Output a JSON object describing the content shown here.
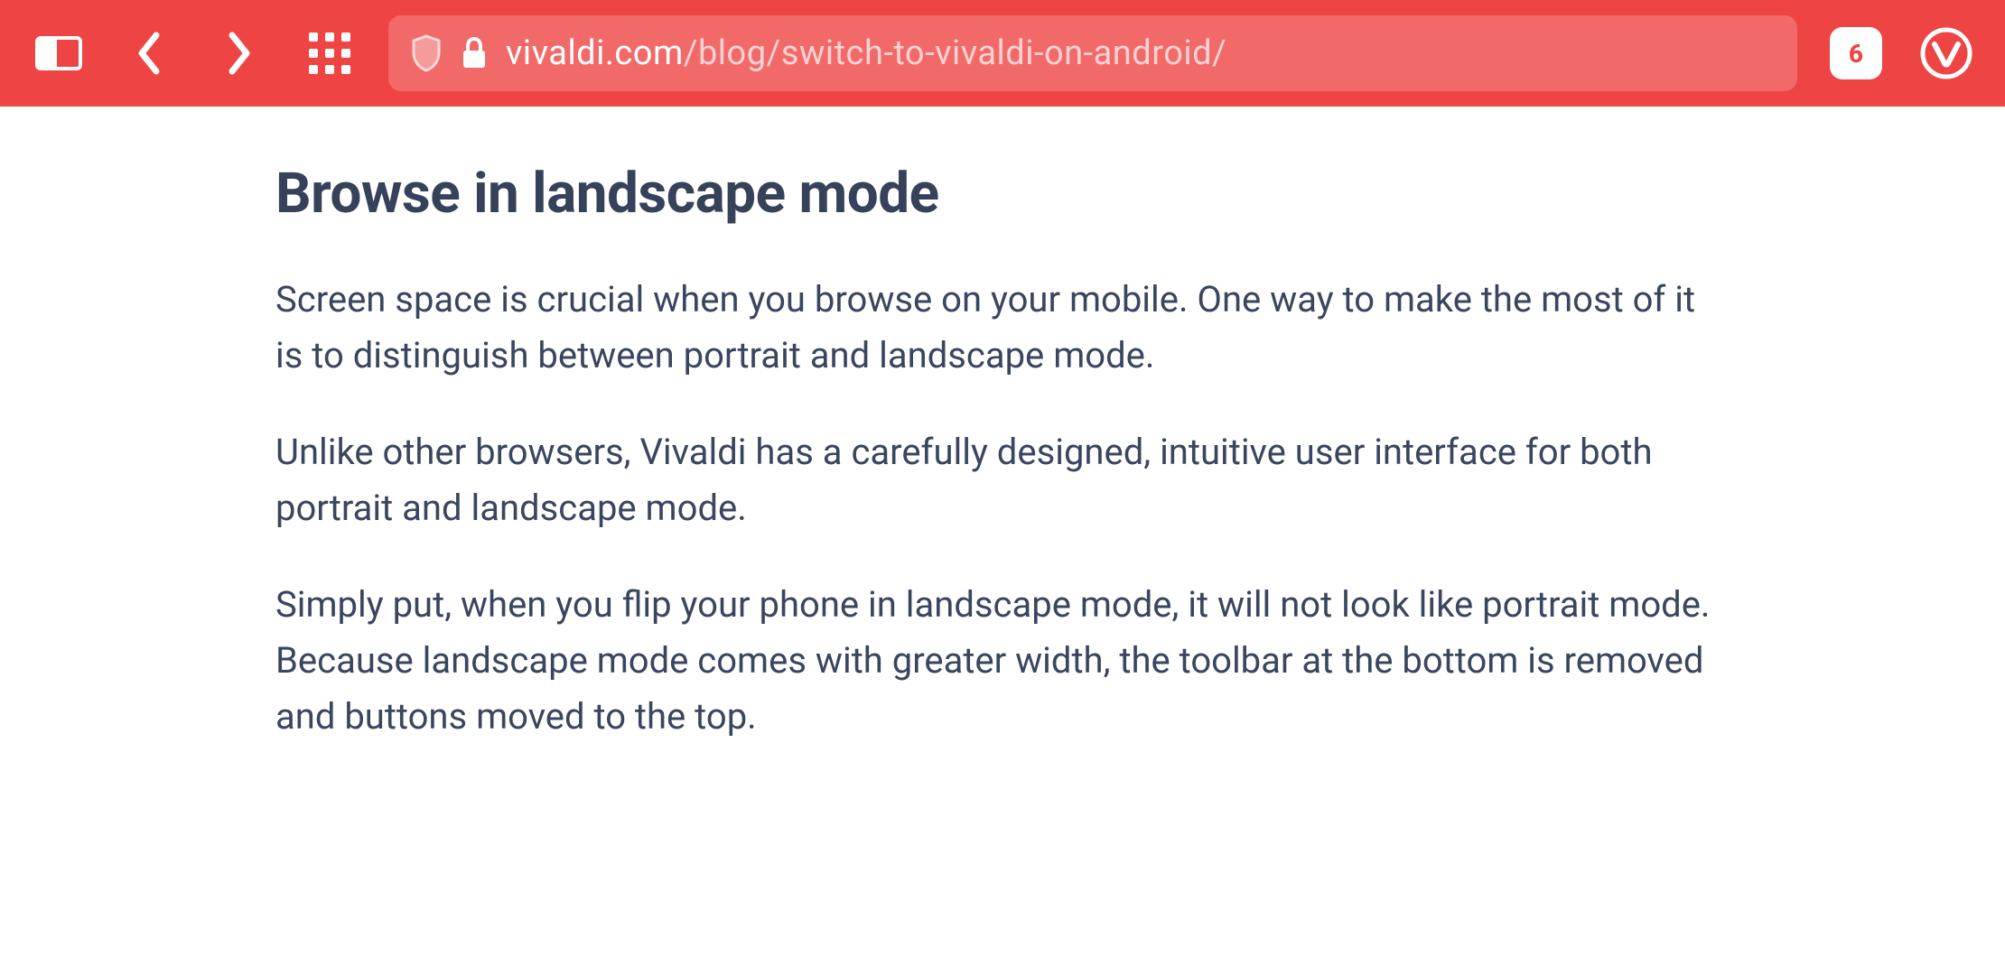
{
  "toolbar": {
    "url_domain": "vivaldi.com",
    "url_path": "/blog/switch-to-vivaldi-on-android/",
    "tab_count": "6"
  },
  "article": {
    "heading": "Browse in landscape mode",
    "paragraphs": [
      "Screen space is crucial when you browse on your mobile. One way to make the most of it is to distinguish between portrait and landscape mode.",
      "Unlike other browsers, Vivaldi has a carefully designed, intuitive user interface for both portrait and landscape mode.",
      "Simply put, when you flip your phone in landscape mode, it will not look like portrait mode. Because landscape mode comes with greater width, the toolbar at the bottom is removed and buttons moved to the top."
    ]
  },
  "colors": {
    "accent": "#ef4444",
    "text": "#36415a"
  }
}
